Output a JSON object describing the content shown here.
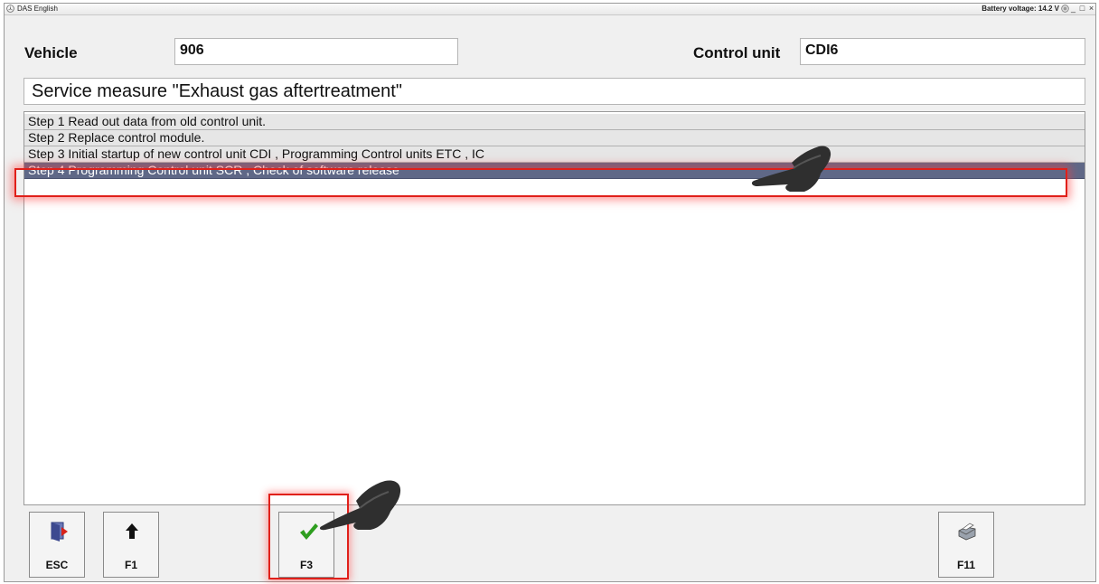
{
  "window": {
    "title": "DAS English",
    "battery_status": "Battery voltage: 14.2 V",
    "controls": {
      "minimize": "_",
      "maximize": "□",
      "close": "×"
    }
  },
  "header": {
    "vehicle_label": "Vehicle",
    "vehicle_value": "906",
    "control_unit_label": "Control unit",
    "control_unit_value": "CDI6"
  },
  "service_title": "Service measure \"Exhaust gas aftertreatment\"",
  "steps": [
    {
      "label": "Step 1 Read out data from old control unit.",
      "selected": false
    },
    {
      "label": "Step 2 Replace control module.",
      "selected": false
    },
    {
      "label": "Step 3 Initial startup of new control unit CDI , Programming Control units ETC , IC",
      "selected": false
    },
    {
      "label": "Step 4 Programming Control unit SCR , Check of software release",
      "selected": true
    }
  ],
  "function_keys": [
    {
      "label": "ESC",
      "icon": "exit-door-icon"
    },
    {
      "label": "F1",
      "icon": "arrow-up-icon"
    },
    {
      "label": "F3",
      "icon": "green-checkmark-icon",
      "highlighted": true
    },
    {
      "label": "F11",
      "icon": "printer-icon"
    }
  ],
  "colors": {
    "selected_row": "#5f6887",
    "highlight": "#e0201a",
    "check_green": "#2e9e1f"
  }
}
